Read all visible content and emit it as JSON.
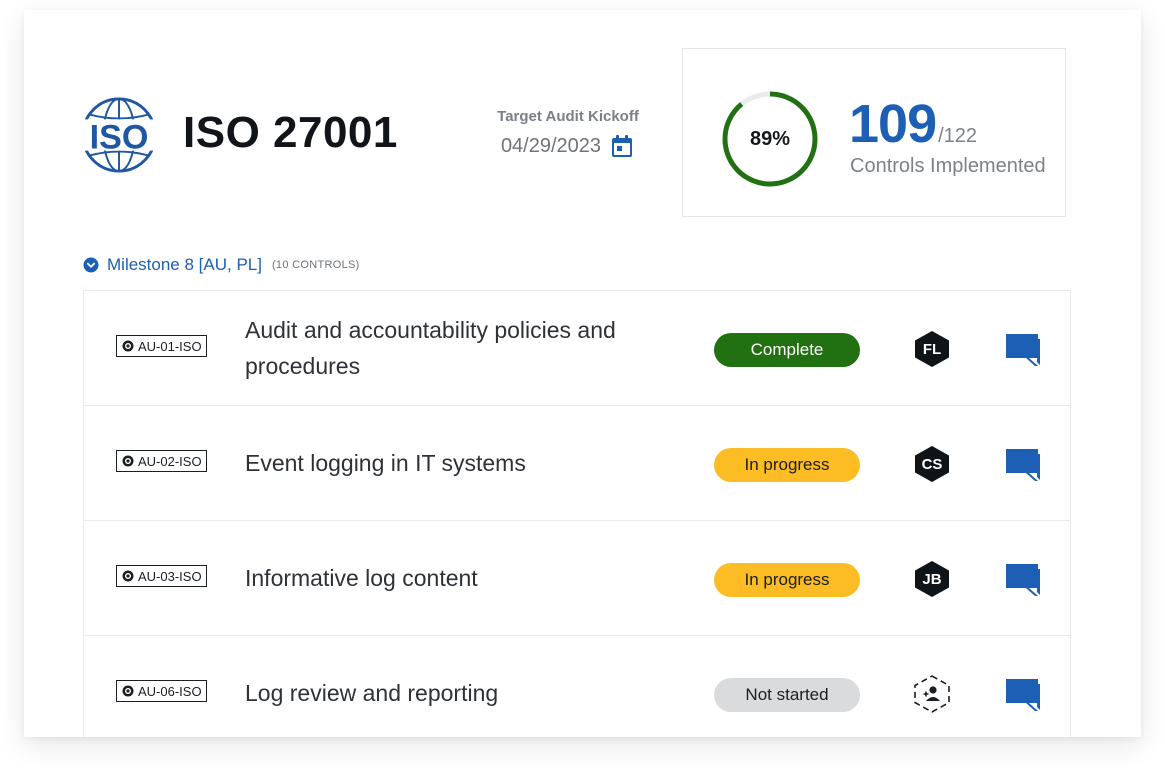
{
  "header": {
    "logo_text": "ISO",
    "standard_title": "ISO 27001",
    "audit_label": "Target Audit Kickoff",
    "audit_date": "04/29/2023",
    "calendar_icon": "calendar-icon"
  },
  "progress": {
    "percent_label": "89%",
    "percent_value": 0.89,
    "implemented": "109",
    "total": "/122",
    "label": "Controls Implemented",
    "ring_color": "#217011"
  },
  "milestone": {
    "title": "Milestone 8 [AU, PL]",
    "count_label": "(10 CONTROLS)",
    "toggle_icon": "chevron-down-circle-icon"
  },
  "colors": {
    "accent": "#1c5fb4",
    "complete": "#217011",
    "in_progress": "#fbbc24",
    "not_started": "#dadbdc"
  },
  "controls": [
    {
      "id": "AU-01-ISO",
      "name": "Audit and accountability policies and procedures",
      "status": "Complete",
      "assignee": "FL"
    },
    {
      "id": "AU-02-ISO",
      "name": "Event logging in IT systems",
      "status": "In progress",
      "assignee": "CS"
    },
    {
      "id": "AU-03-ISO",
      "name": "Informative log content",
      "status": "In progress",
      "assignee": "JB"
    },
    {
      "id": "AU-06-ISO",
      "name": "Log review and reporting",
      "status": "Not started",
      "assignee": ""
    }
  ]
}
